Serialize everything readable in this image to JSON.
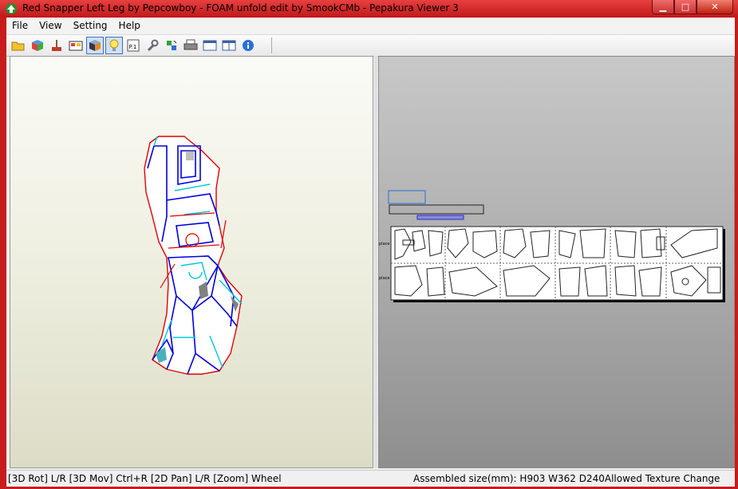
{
  "window": {
    "title": "Red Snapper Left Leg by Pepcowboy - FOAM unfold edit by SmookCMb - Pepakura Viewer 3",
    "minimize_glyph": "▁",
    "maximize_glyph": "□",
    "close_glyph": "✕"
  },
  "menu": {
    "items": [
      "File",
      "View",
      "Setting",
      "Help"
    ]
  },
  "toolbar": {
    "buttons": [
      {
        "icon": "open-folder-icon"
      },
      {
        "icon": "3d-model-icon"
      },
      {
        "icon": "paint-brush-icon"
      },
      {
        "icon": "texture-icon"
      },
      {
        "icon": "cube-view-icon",
        "active": true
      },
      {
        "icon": "light-bulb-icon",
        "active": true
      },
      {
        "icon": "page-number-icon",
        "label": "P.1"
      },
      {
        "icon": "wrench-icon"
      },
      {
        "icon": "unfold-icon"
      },
      {
        "icon": "print-icon"
      },
      {
        "icon": "single-pane-icon"
      },
      {
        "icon": "dual-pane-icon"
      },
      {
        "icon": "info-icon"
      }
    ]
  },
  "pattern": {
    "page_labels": [
      "place",
      "place"
    ]
  },
  "statusbar": {
    "left": "[3D Rot] L/R [3D Mov] Ctrl+R [2D Pan] L/R [Zoom] Wheel",
    "right": "Assembled size(mm): H903 W362 D240Allowed Texture Change"
  },
  "colors": {
    "title_red": "#c81c1c",
    "edge_red": "#e00000",
    "edge_blue": "#0000e0",
    "edge_cyan": "#00c8d8",
    "selection_blue": "#2a6fd8"
  }
}
